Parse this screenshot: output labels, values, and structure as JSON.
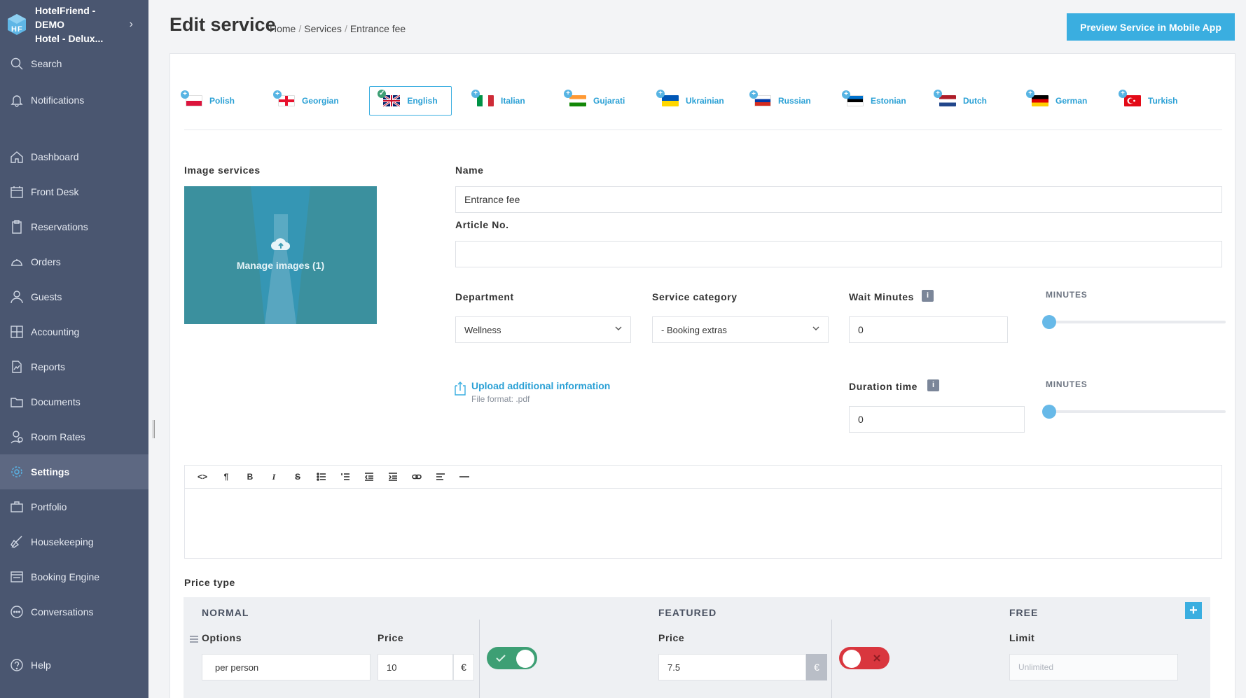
{
  "brand": {
    "line1": "HotelFriend - DEMO",
    "line2": "Hotel - Delux..."
  },
  "sidebar": {
    "items": [
      {
        "label": "Search",
        "icon": "search-icon"
      },
      {
        "label": "Notifications",
        "icon": "bell-icon"
      },
      {
        "label": "Dashboard",
        "icon": "home-icon"
      },
      {
        "label": "Front Desk",
        "icon": "calendar-icon"
      },
      {
        "label": "Reservations",
        "icon": "clipboard-icon"
      },
      {
        "label": "Orders",
        "icon": "cloche-icon"
      },
      {
        "label": "Guests",
        "icon": "user-icon"
      },
      {
        "label": "Accounting",
        "icon": "calculator-icon"
      },
      {
        "label": "Reports",
        "icon": "chart-file-icon"
      },
      {
        "label": "Documents",
        "icon": "folder-icon"
      },
      {
        "label": "Room Rates",
        "icon": "rates-icon"
      },
      {
        "label": "Settings",
        "icon": "gear-icon",
        "active": true
      },
      {
        "label": "Portfolio",
        "icon": "portfolio-icon"
      },
      {
        "label": "Housekeeping",
        "icon": "broom-icon"
      },
      {
        "label": "Booking Engine",
        "icon": "booking-engine-icon"
      },
      {
        "label": "Conversations",
        "icon": "chat-icon"
      },
      {
        "label": "Help",
        "icon": "help-icon"
      }
    ]
  },
  "header": {
    "title": "Edit service",
    "breadcrumb": [
      "Home",
      "Services",
      "Entrance fee"
    ],
    "preview_button": "Preview Service in Mobile App"
  },
  "languages": [
    {
      "label": "Polish"
    },
    {
      "label": "Georgian"
    },
    {
      "label": "English",
      "active": true
    },
    {
      "label": "Italian"
    },
    {
      "label": "Gujarati"
    },
    {
      "label": "Ukrainian"
    },
    {
      "label": "Russian"
    },
    {
      "label": "Estonian"
    },
    {
      "label": "Dutch"
    },
    {
      "label": "German"
    },
    {
      "label": "Turkish"
    }
  ],
  "form": {
    "image_label": "Image services",
    "manage_images": "Manage images (1)",
    "name_label": "Name",
    "name_value": "Entrance fee",
    "article_label": "Article No.",
    "article_value": "",
    "department_label": "Department",
    "department_value": "Wellness",
    "category_label": "Service category",
    "category_value": "- Booking extras",
    "wait_label": "Wait Minutes",
    "wait_value": "0",
    "duration_label": "Duration time",
    "duration_value": "0",
    "minutes_label": "MINUTES",
    "upload_link": "Upload additional information",
    "upload_sub": "File format: .pdf"
  },
  "price": {
    "section_label": "Price type",
    "normal_title": "NORMAL",
    "featured_title": "FEATURED",
    "free_title": "FREE",
    "options_label": "Options",
    "options_value": "per person",
    "price_label": "Price",
    "normal_price": "10",
    "featured_price": "7.5",
    "currency": "€",
    "limit_label": "Limit",
    "limit_placeholder": "Unlimited",
    "add_symbol": "+"
  },
  "colors": {
    "accent": "#3aaee0",
    "sidebar": "#4a5670",
    "toggle_on": "#3d9f74",
    "toggle_off": "#d9363e"
  }
}
